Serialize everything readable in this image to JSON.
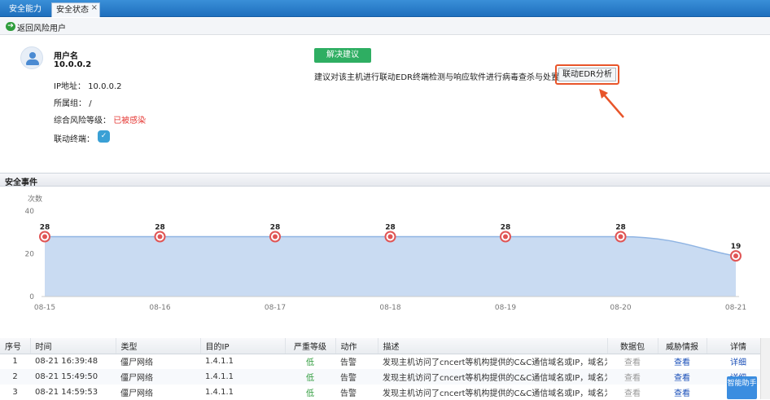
{
  "tabs": [
    {
      "label": "安全能力"
    },
    {
      "label": "安全状态",
      "close": "×"
    }
  ],
  "back": {
    "label": "返回风险用户"
  },
  "user": {
    "name_label": "用户名",
    "ip_short": "10.0.0.2",
    "ip_label": "IP地址：",
    "ip_value": "10.0.0.2",
    "group_label": "所属组：",
    "group_value": "/",
    "risk_label": "综合风险等级：",
    "risk_value": "已被感染",
    "endpoint_label": "联动终端："
  },
  "advice": {
    "solve_button": "解决建议",
    "text": "建议对该主机进行联动EDR终端检测与响应软件进行病毒查杀与处置。",
    "edr_button": "联动EDR分析"
  },
  "section_title": "安全事件",
  "chart_data": {
    "type": "area",
    "ylabel": "次数",
    "categories": [
      "08-15",
      "08-16",
      "08-17",
      "08-18",
      "08-19",
      "08-20",
      "08-21"
    ],
    "series": [
      {
        "values": [
          28,
          28,
          28,
          28,
          28,
          28,
          19
        ]
      }
    ],
    "ylim": [
      0,
      40
    ],
    "yticks": [
      0,
      20,
      40
    ],
    "grid": false,
    "colors": {
      "fill": "#c9dbf2",
      "line": "#8fb4e3",
      "marker": "#e05555"
    }
  },
  "table": {
    "headers": [
      "序号",
      "时间",
      "类型",
      "目的IP",
      "严重等级",
      "动作",
      "描述",
      "数据包",
      "威胁情报",
      "详情"
    ],
    "rows": [
      {
        "no": "1",
        "time": "08-21 16:39:48",
        "type": "僵尸网络",
        "ip": "1.4.1.1",
        "level": "低",
        "action": "告警",
        "desc": "发现主机访问了cncert等机构提供的C&C通信域名或IP，域名为",
        "pkt": "查看",
        "intel": "查看",
        "detail": "详细"
      },
      {
        "no": "2",
        "time": "08-21 15:49:50",
        "type": "僵尸网络",
        "ip": "1.4.1.1",
        "level": "低",
        "action": "告警",
        "desc": "发现主机访问了cncert等机构提供的C&C通信域名或IP，域名为",
        "pkt": "查看",
        "intel": "查看",
        "detail": "详细"
      },
      {
        "no": "3",
        "time": "08-21 14:59:53",
        "type": "僵尸网络",
        "ip": "1.4.1.1",
        "level": "低",
        "action": "告警",
        "desc": "发现主机访问了cncert等机构提供的C&C通信域名或IP，域名为",
        "pkt": "查看",
        "intel": "查看",
        "detail": "详细"
      }
    ]
  },
  "smart_button": "智能助手"
}
